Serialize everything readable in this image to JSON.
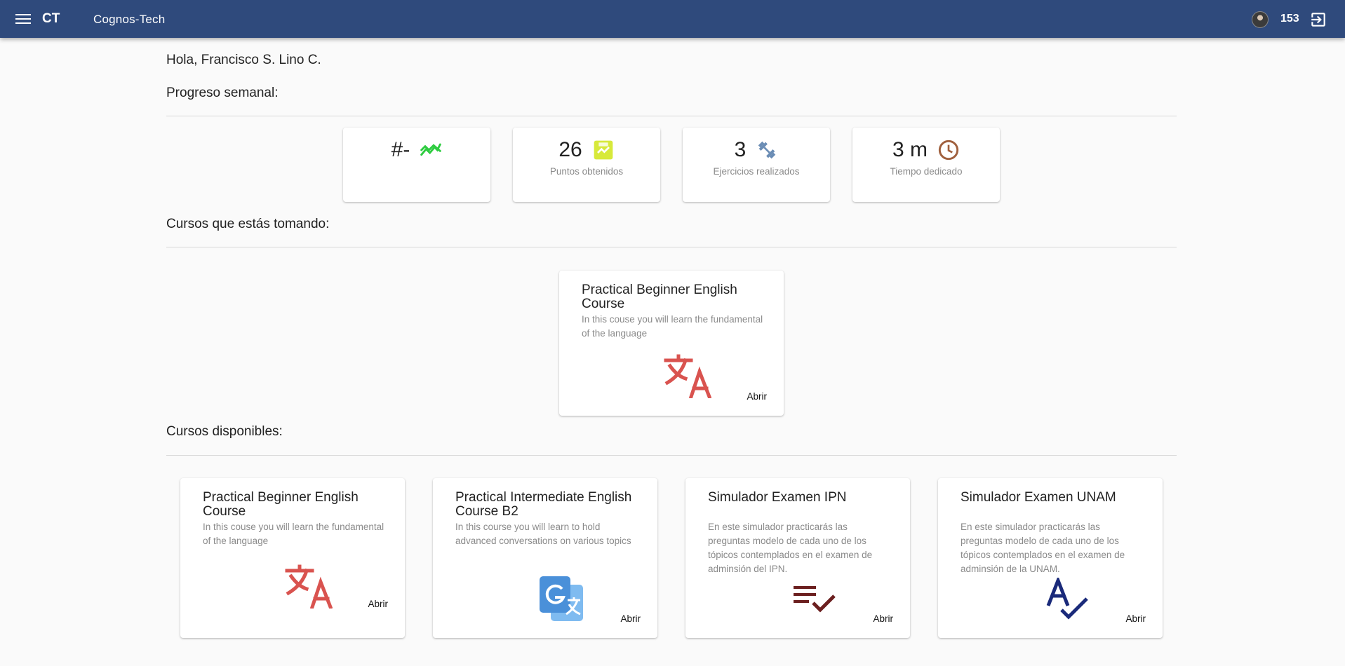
{
  "header": {
    "brand": "CT",
    "app_title": "Cognos-Tech",
    "points": "153"
  },
  "greeting": "Hola, Francisco S. Lino C.",
  "weekly_progress": {
    "title": "Progreso semanal:",
    "stats": [
      {
        "value": "#-",
        "label": "",
        "icon": "trending-icon",
        "color": "#2ecc40"
      },
      {
        "value": "26",
        "label": "Puntos obtenidos",
        "icon": "points-badge-icon",
        "color": "#d7e93a"
      },
      {
        "value": "3",
        "label": "Ejercicios realizados",
        "icon": "dumbbell-icon",
        "color": "#6b8db5"
      },
      {
        "value": "3 m",
        "label": "Tiempo dedicado",
        "icon": "clock-icon",
        "color": "#a0603e"
      }
    ]
  },
  "current_courses": {
    "title": "Cursos que estás tomando:",
    "items": [
      {
        "title": "Practical Beginner English Course",
        "desc": "In this couse you will learn the fundamental of the language",
        "action": "Abrir",
        "icon": "translate-icon"
      }
    ]
  },
  "available_courses": {
    "title": "Cursos disponibles:",
    "items": [
      {
        "title": "Practical Beginner English Course",
        "desc": "In this couse you will learn the fundamental of the language",
        "action": "Abrir",
        "icon": "translate-icon"
      },
      {
        "title": "Practical Intermediate English Course B2",
        "desc": "In this course you will learn to hold advanced conversations on various topics",
        "action": "Abrir",
        "icon": "google-translate-icon"
      },
      {
        "title": "Simulador Examen IPN",
        "desc": "En este simulador practicarás las preguntas modelo de cada uno de los tópicos contemplados en el examen de adminsión del IPN.",
        "action": "Abrir",
        "icon": "checklist-icon"
      },
      {
        "title": "Simulador Examen UNAM",
        "desc": "En este simulador practicarás las preguntas modelo de cada uno de los tópicos contemplados en el examen de adminsión de la UNAM.",
        "action": "Abrir",
        "icon": "spellcheck-icon"
      }
    ]
  },
  "colors": {
    "header_bg": "#2f4a7c",
    "translate_red": "#d9534f",
    "google_blue": "#4a90d9",
    "checklist_maroon": "#6b1f1f",
    "spellcheck_navy": "#1a2a7a"
  }
}
